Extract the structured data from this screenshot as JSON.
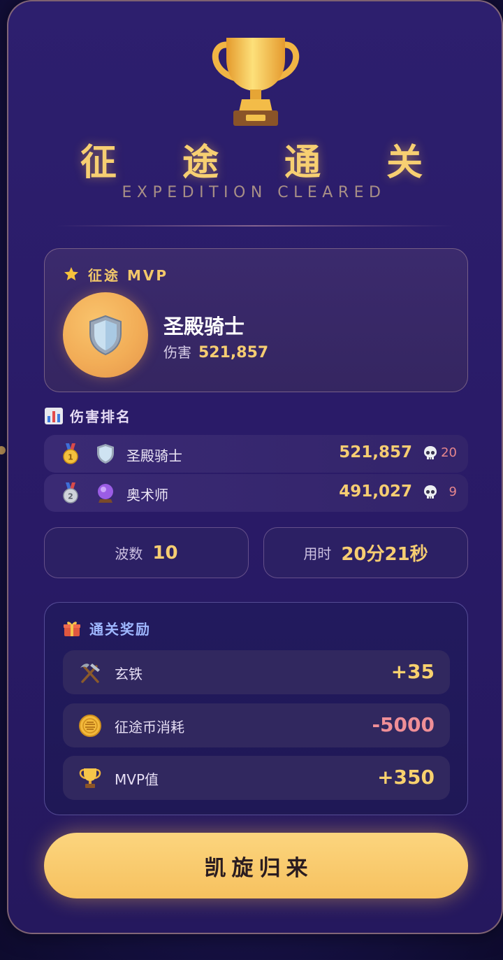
{
  "header": {
    "title_cn": "征 途 通 关",
    "title_en": "EXPEDITION CLEARED",
    "trophy_icon": "trophy-icon"
  },
  "mvp": {
    "label": "征途 MVP",
    "icon": "star-icon",
    "avatar_icon": "shield-icon",
    "name": "圣殿骑士",
    "damage_label": "伤害",
    "damage_value": "521,857"
  },
  "ranking": {
    "title": "伤害排名",
    "icon": "bar-chart-icon",
    "rows": [
      {
        "medal": "gold-medal-icon",
        "class_icon": "shield-icon",
        "name": "圣殿骑士",
        "damage": "521,857",
        "kills": "20"
      },
      {
        "medal": "silver-medal-icon",
        "class_icon": "crystal-ball-icon",
        "name": "奥术师",
        "damage": "491,027",
        "kills": "9"
      }
    ]
  },
  "stats": {
    "wave_label": "波数",
    "wave_value": "10",
    "time_label": "用时",
    "time_value": "20分21秒"
  },
  "rewards": {
    "title": "通关奖励",
    "icon": "gift-icon",
    "items": [
      {
        "icon": "hammer-pick-icon",
        "name": "玄铁",
        "value": "+35"
      },
      {
        "icon": "coin-icon",
        "name": "征途币消耗",
        "value": "-5000"
      },
      {
        "icon": "trophy-icon",
        "name": "MVP值",
        "value": "+350"
      }
    ]
  },
  "actions": {
    "return_label": "凯旋归来"
  },
  "colors": {
    "gold": "#f6cd72",
    "negative": "#ef8f97",
    "background": "#2a1b68",
    "button": "#f6c15f"
  }
}
